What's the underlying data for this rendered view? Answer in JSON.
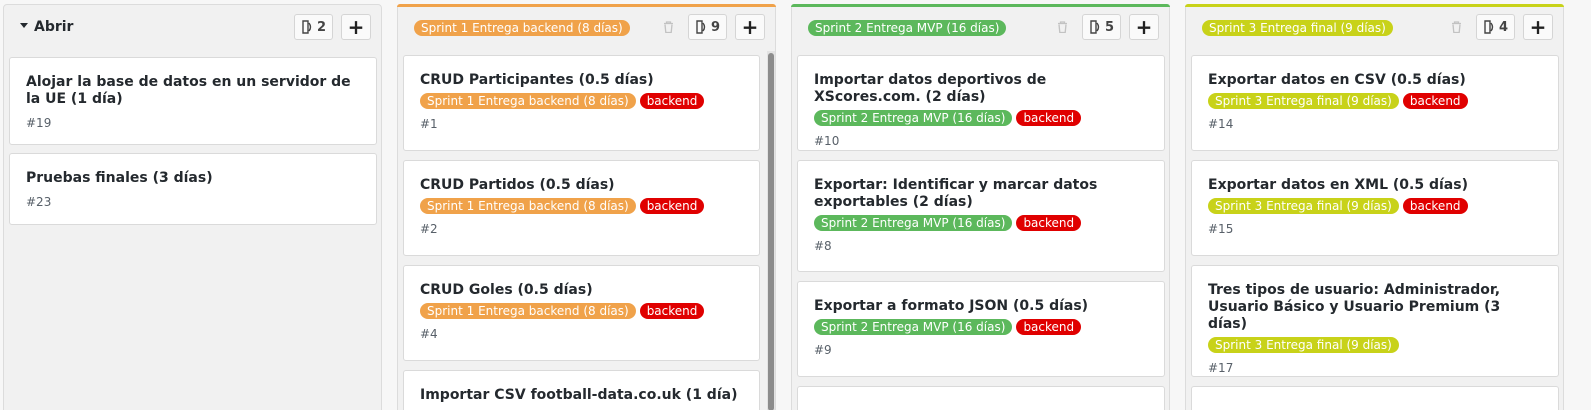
{
  "colors": {
    "sprint1": "#f0a24a",
    "sprint2": "#5cb85c",
    "sprint3": "#c8d219",
    "backend": "#e00000"
  },
  "columns": [
    {
      "title": "Abrir",
      "count": "2",
      "cards": [
        {
          "title": "Alojar la base de datos en un servidor de la UE (1 día)",
          "labels": [],
          "number": "#19"
        },
        {
          "title": "Pruebas finales (3 días)",
          "labels": [],
          "number": "#23"
        }
      ]
    },
    {
      "title": "Sprint 1 Entrega backend (8 días)",
      "count": "9",
      "cards": [
        {
          "title": "CRUD Participantes (0.5 días)",
          "labels": [
            "Sprint 1 Entrega backend (8 días)",
            "backend"
          ],
          "number": "#1"
        },
        {
          "title": "CRUD Partidos (0.5 días)",
          "labels": [
            "Sprint 1 Entrega backend (8 días)",
            "backend"
          ],
          "number": "#2"
        },
        {
          "title": "CRUD Goles (0.5 días)",
          "labels": [
            "Sprint 1 Entrega backend (8 días)",
            "backend"
          ],
          "number": "#4"
        },
        {
          "title": "Importar CSV football-data.co.uk (1 día)",
          "labels": [],
          "number": ""
        }
      ]
    },
    {
      "title": "Sprint 2 Entrega MVP (16 días)",
      "count": "5",
      "cards": [
        {
          "title": "Importar datos deportivos de XScores.com. (2 días)",
          "labels": [
            "Sprint 2 Entrega MVP (16 días)",
            "backend"
          ],
          "number": "#10"
        },
        {
          "title": "Exportar: Identificar y marcar datos exportables (2 días)",
          "labels": [
            "Sprint 2 Entrega MVP (16 días)",
            "backend"
          ],
          "number": "#8"
        },
        {
          "title": "Exportar a formato JSON (0.5 días)",
          "labels": [
            "Sprint 2 Entrega MVP (16 días)",
            "backend"
          ],
          "number": "#9"
        }
      ]
    },
    {
      "title": "Sprint 3 Entrega final (9 días)",
      "count": "4",
      "cards": [
        {
          "title": "Exportar datos en CSV (0.5 días)",
          "labels": [
            "Sprint 3 Entrega final (9 días)",
            "backend"
          ],
          "number": "#14"
        },
        {
          "title": "Exportar datos en XML (0.5 días)",
          "labels": [
            "Sprint 3 Entrega final (9 días)",
            "backend"
          ],
          "number": "#15"
        },
        {
          "title": "Tres tipos de usuario: Administrador, Usuario Básico y Usuario Premium (3 días)",
          "labels": [
            "Sprint 3 Entrega final (9 días)"
          ],
          "number": "#17"
        }
      ]
    }
  ]
}
